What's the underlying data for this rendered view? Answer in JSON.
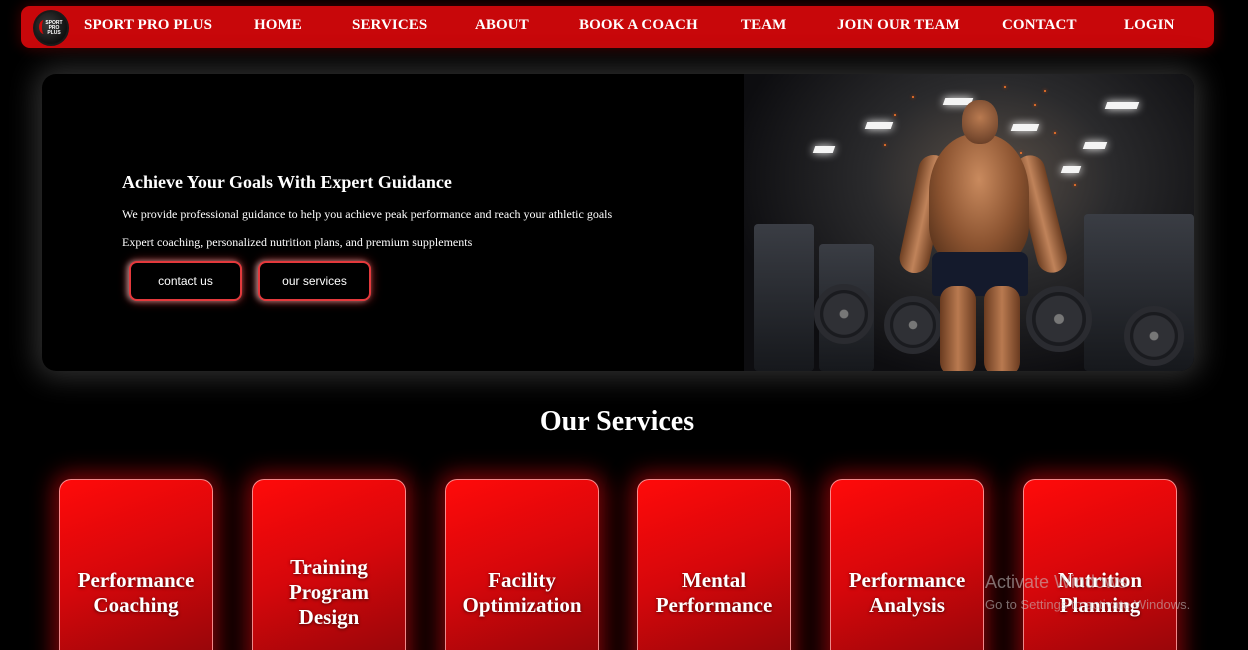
{
  "brand": {
    "logo_text": "SPORT PRO PLUS",
    "name": "SPORT PRO PLUS"
  },
  "nav": {
    "home": "HOME",
    "services": "SERVICES",
    "about": "ABOUT",
    "book_coach": "BOOK A COACH",
    "team": "TEAM",
    "join_team": "JOIN OUR TEAM",
    "contact": "CONTACT",
    "login": "LOGIN"
  },
  "hero": {
    "title": "Achieve Your Goals With Expert Guidance",
    "subtitle1": "We provide professional guidance to help you achieve peak performance and reach your athletic goals",
    "subtitle2": "Expert coaching, personalized nutrition plans, and premium supplements",
    "btn_contact": "contact us",
    "btn_services": "our services"
  },
  "services": {
    "title": "Our Services",
    "cards": [
      {
        "line1": "Performance",
        "line2": "Coaching"
      },
      {
        "line1": "Training",
        "line2": "Program",
        "line3": "Design"
      },
      {
        "line1": "Facility",
        "line2": "Optimization"
      },
      {
        "line1": "Mental",
        "line2": "Performance"
      },
      {
        "line1": "Performance",
        "line2": "Analysis"
      },
      {
        "line1": "Nutrition",
        "line2": "Planning"
      }
    ]
  },
  "watermark": {
    "line1": "Activate Windows",
    "line2": "Go to Settings to activate Windows."
  }
}
